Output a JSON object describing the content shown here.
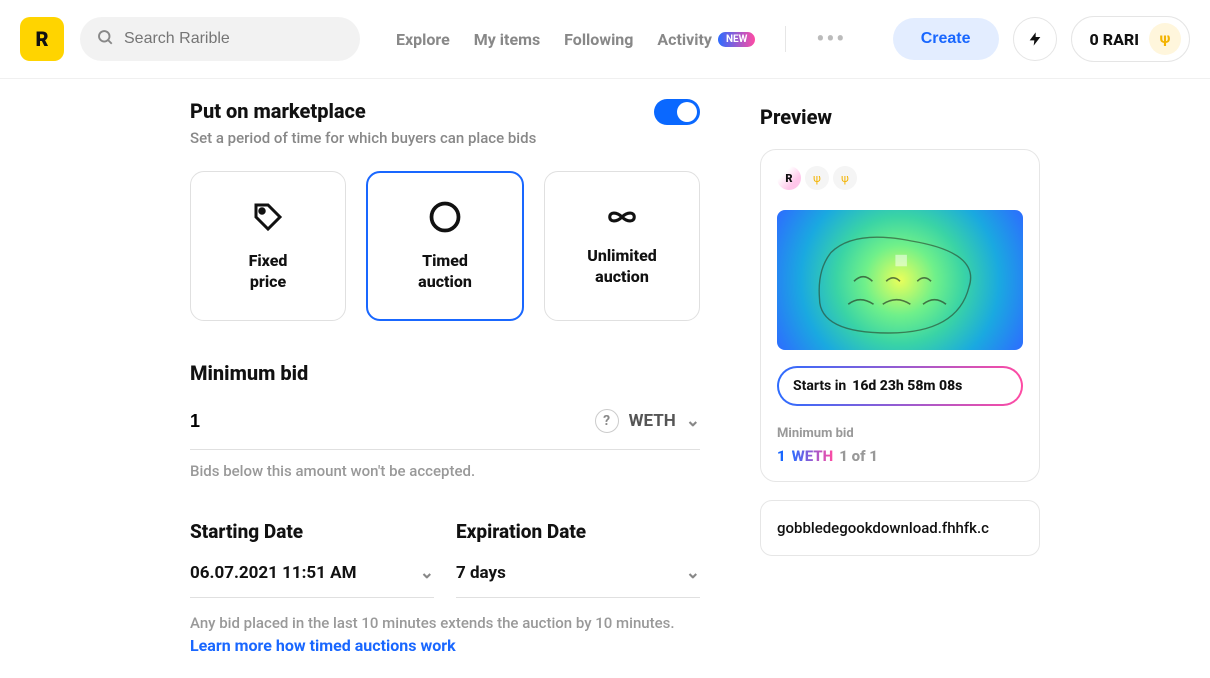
{
  "header": {
    "logo_letter": "R",
    "search_placeholder": "Search Rarible",
    "nav": {
      "explore": "Explore",
      "my_items": "My items",
      "following": "Following",
      "activity": "Activity",
      "new_badge": "NEW"
    },
    "create_label": "Create",
    "rari_balance": "0 RARI"
  },
  "marketplace": {
    "title": "Put on marketplace",
    "subtitle": "Set a period of time for which buyers can place bids",
    "toggle_on": true,
    "options": {
      "fixed": "Fixed\nprice",
      "timed": "Timed\nauction",
      "unlimited": "Unlimited\nauction"
    }
  },
  "min_bid": {
    "label": "Minimum bid",
    "value": "1",
    "currency": "WETH",
    "hint": "Bids below this amount won't be accepted."
  },
  "dates": {
    "start_label": "Starting Date",
    "start_value": "06.07.2021 11:51 AM",
    "exp_label": "Expiration Date",
    "exp_value": "7 days",
    "note": "Any bid placed in the last 10 minutes extends the auction by 10 minutes.",
    "link": "Learn more how timed auctions work"
  },
  "preview": {
    "title": "Preview",
    "starts_label": "Starts in",
    "starts_value": "16d  23h 58m 08s",
    "min_label": "Minimum bid",
    "price_amount": "1",
    "price_currency": "WETH",
    "edition": "1 of 1",
    "url": "gobbledegookdownload.fhhfk.c"
  }
}
